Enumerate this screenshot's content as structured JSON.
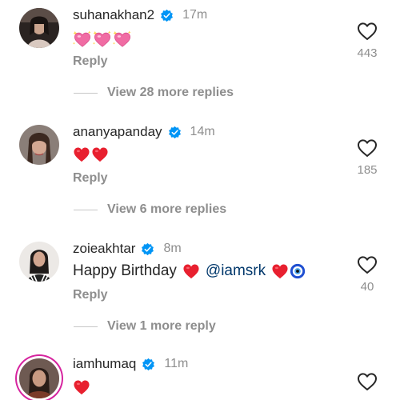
{
  "comments": [
    {
      "username": "suhanakhan2",
      "time": "17m",
      "reply": "Reply",
      "likes": "443",
      "view_more": "View 28 more replies",
      "emojis": [
        "sparkling-heart",
        "sparkling-heart",
        "sparkling-heart"
      ]
    },
    {
      "username": "ananyapanday",
      "time": "14m",
      "reply": "Reply",
      "likes": "185",
      "view_more": "View 6 more replies",
      "emojis": [
        "red-heart",
        "red-heart"
      ]
    },
    {
      "username": "zoieakhtar",
      "time": "8m",
      "text_start": "Happy Birthday",
      "mention": "@iamsrk",
      "reply": "Reply",
      "likes": "40",
      "view_more": "View 1 more reply",
      "emojis": [
        "red-heart",
        "red-heart",
        "nazar-amulet"
      ]
    },
    {
      "username": "iamhumaq",
      "time": "11m",
      "emojis": [
        "red-heart"
      ]
    }
  ],
  "colors": {
    "verified_badge": "#0095f6",
    "red_heart": "#e8202f",
    "sparkle_heart": "#f06ca3",
    "muted_text": "#8e8e8e",
    "mention": "#00376b",
    "story_ring": "#d6249f"
  }
}
